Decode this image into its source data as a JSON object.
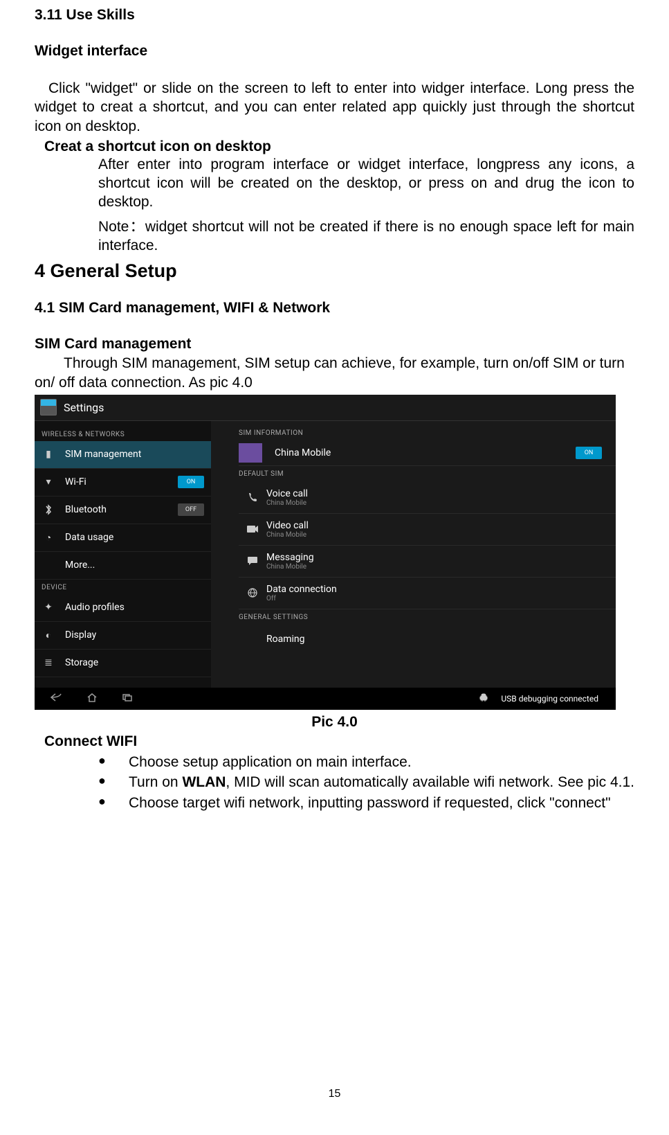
{
  "doc": {
    "h311": "3.11 Use Skills",
    "widget_interface_heading": "Widget interface",
    "para1": "Click \"widget\" or slide on the screen to left to enter into widger interface. Long press the widget to creat a shortcut, and you can enter related app quickly just through the shortcut icon on desktop.",
    "shortcut_heading": "Creat a shortcut icon on desktop",
    "shortcut_para1_first": "After enter into program interface or widget interface, longpress any icons, a",
    "shortcut_para1_rest": "shortcut icon will be created on the desktop, or press on and drug the icon to desktop.",
    "shortcut_para2": "Note：widget shortcut will not be created if there is no enough space left for main interface.",
    "h4": "4 General Setup",
    "h41": "4.1 SIM Card management, WIFI & Network",
    "sim_heading": "SIM Card management",
    "sim_para": "Through SIM management, SIM setup can achieve, for example, turn on/off SIM or turn on/ off data connection. As pic 4.0",
    "caption": "Pic 4.0",
    "connect_wifi_heading": "Connect WIFI",
    "bullet1": "Choose setup application on main interface.",
    "bullet2_pre": "Turn on ",
    "bullet2_bold": "WLAN",
    "bullet2_post": ", MID will scan automatically available wifi network. See pic 4.1.",
    "bullet3": "Choose target wifi network, inputting password if requested, click \"connect\"",
    "page_number": "15"
  },
  "screenshot": {
    "title": "Settings",
    "left_categories": {
      "wireless": "WIRELESS & NETWORKS",
      "device": "DEVICE"
    },
    "nav": {
      "sim": "SIM management",
      "wifi": "Wi-Fi",
      "wifi_state": "ON",
      "bluetooth": "Bluetooth",
      "bluetooth_state": "OFF",
      "data_usage": "Data usage",
      "more": "More...",
      "audio": "Audio profiles",
      "display": "Display",
      "storage": "Storage"
    },
    "right": {
      "sim_info": "SIM INFORMATION",
      "china_mobile": "China Mobile",
      "china_mobile_state": "ON",
      "default_sim": "DEFAULT SIM",
      "voice_call": "Voice call",
      "voice_call_sub": "China Mobile",
      "video_call": "Video call",
      "video_call_sub": "China Mobile",
      "messaging": "Messaging",
      "messaging_sub": "China Mobile",
      "data_conn": "Data connection",
      "data_conn_sub": "Off",
      "general_settings": "GENERAL SETTINGS",
      "roaming": "Roaming"
    },
    "usb": "USB debugging connected"
  }
}
